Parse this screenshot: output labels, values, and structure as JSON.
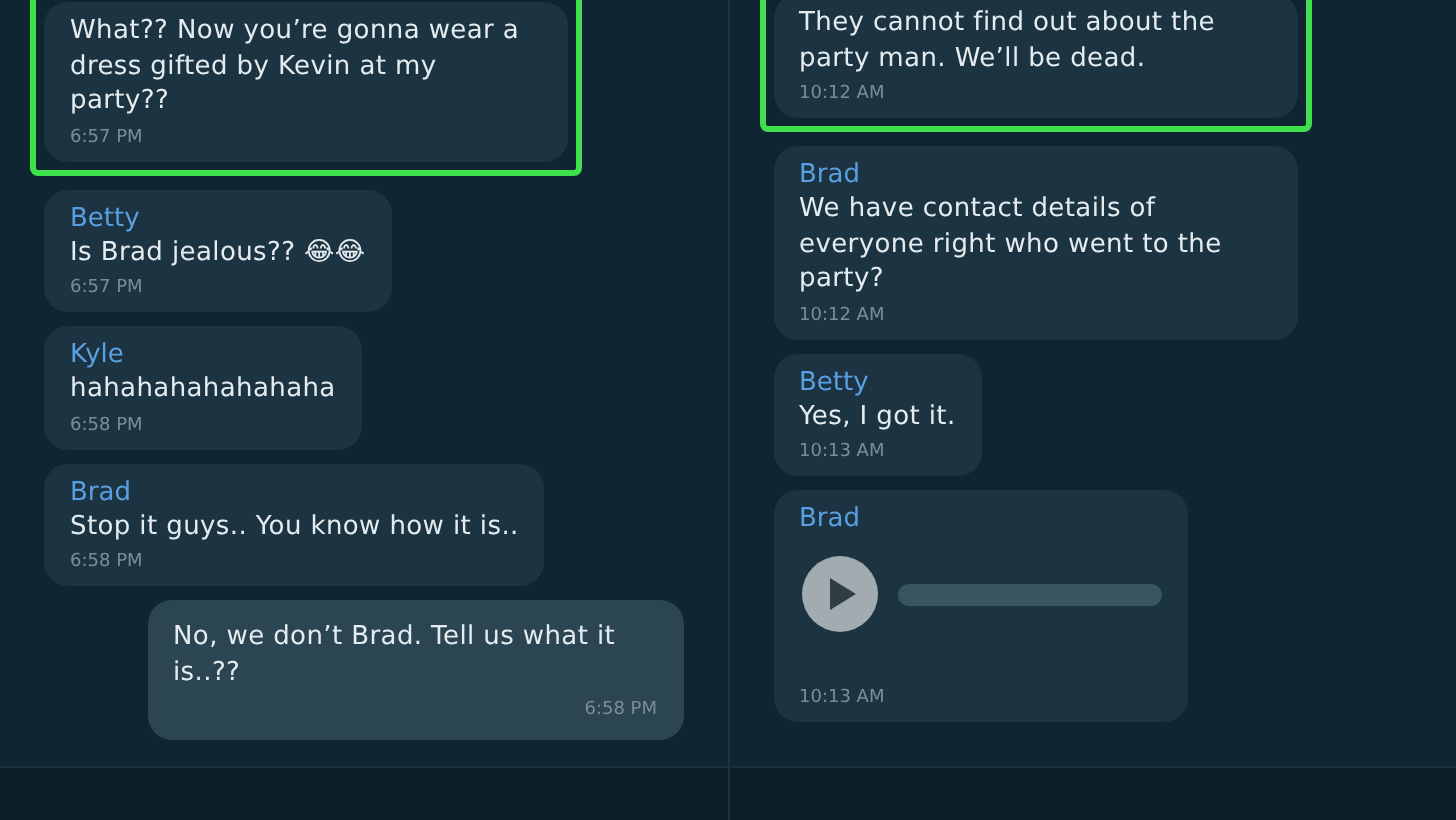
{
  "panels": [
    {
      "messages": [
        {
          "kind": "text",
          "outgoing": false,
          "highlighted": true,
          "text": "What?? Now you’re gonna wear a dress gifted by Kevin at my party??",
          "time": "6:57 PM"
        },
        {
          "kind": "text",
          "outgoing": false,
          "highlighted": false,
          "sender": "Betty",
          "text": "Is Brad jealous?? 😂😂",
          "time": "6:57 PM"
        },
        {
          "kind": "text",
          "outgoing": false,
          "highlighted": false,
          "sender": "Kyle",
          "text": "hahahahahahahaha",
          "time": "6:58 PM"
        },
        {
          "kind": "text",
          "outgoing": false,
          "highlighted": false,
          "sender": "Brad",
          "text": "Stop it guys.. You know how it is..",
          "time": "6:58 PM"
        },
        {
          "kind": "text",
          "outgoing": true,
          "highlighted": false,
          "text": "No, we don’t Brad. Tell us what it is..??",
          "time": "6:58 PM"
        }
      ]
    },
    {
      "messages": [
        {
          "kind": "text",
          "outgoing": false,
          "highlighted": true,
          "text": "They cannot find out about the party man. We’ll be dead.",
          "time": "10:12 AM"
        },
        {
          "kind": "text",
          "outgoing": false,
          "highlighted": false,
          "sender": "Brad",
          "text": "We have contact details of everyone right who went to the party?",
          "time": "10:12 AM"
        },
        {
          "kind": "text",
          "outgoing": false,
          "highlighted": false,
          "sender": "Betty",
          "text": "Yes, I got it.",
          "time": "10:13 AM"
        },
        {
          "kind": "voice",
          "outgoing": false,
          "highlighted": false,
          "sender": "Brad",
          "time": "10:13 AM"
        }
      ]
    }
  ]
}
